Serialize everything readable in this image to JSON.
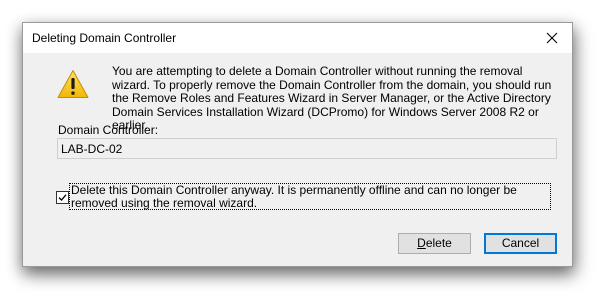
{
  "dialog": {
    "title": "Deleting Domain Controller",
    "close_icon": "close-icon",
    "warning_icon": "warning-icon",
    "message": "You are attempting to delete a Domain Controller without running the removal wizard. To properly remove the Domain Controller from the domain, you should run the Remove Roles and Features Wizard in Server Manager, or the Active Directory Domain Services Installation Wizard (DCPromo) for Windows Server 2008 R2 or earlier.",
    "dc_label": "Domain Controller:",
    "dc_value": "LAB-DC-02",
    "checkbox": {
      "checked": true,
      "label": "Delete this Domain Controller anyway. It is permanently offline and can no longer be removed using the removal wizard."
    },
    "buttons": {
      "delete_label": "Delete",
      "cancel_label": "Cancel"
    },
    "colors": {
      "accent": "#0078d7",
      "warning_fill": "#f7c818"
    }
  }
}
